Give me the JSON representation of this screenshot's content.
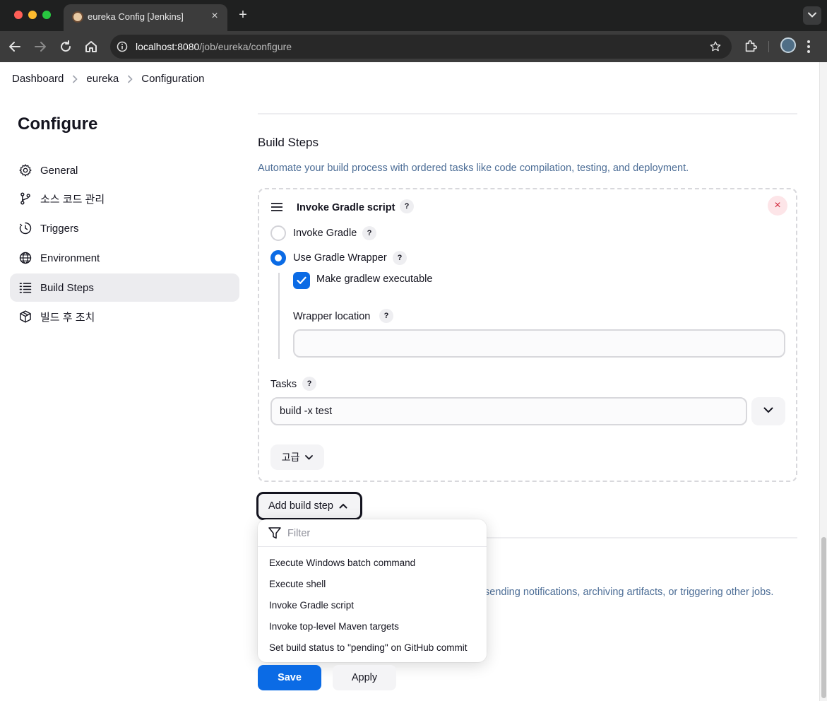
{
  "browser": {
    "tab_title": "eureka Config [Jenkins]",
    "url_host": "localhost:8080",
    "url_path": "/job/eureka/configure",
    "close_glyph": "×",
    "newtab_glyph": "+"
  },
  "breadcrumb": [
    {
      "label": "Dashboard"
    },
    {
      "label": "eureka"
    },
    {
      "label": "Configuration"
    }
  ],
  "sidebar": {
    "title": "Configure",
    "items": [
      {
        "label": "General",
        "icon": "gear-icon"
      },
      {
        "label": "소스 코드 관리",
        "icon": "branch-icon"
      },
      {
        "label": "Triggers",
        "icon": "timer-icon"
      },
      {
        "label": "Environment",
        "icon": "globe-icon"
      },
      {
        "label": "Build Steps",
        "icon": "list-icon",
        "active": true
      },
      {
        "label": "빌드 후 조치",
        "icon": "package-icon"
      }
    ]
  },
  "build_steps": {
    "title": "Build Steps",
    "description": "Automate your build process with ordered tasks like code compilation, testing, and deployment.",
    "step": {
      "title": "Invoke Gradle script",
      "help": "?",
      "close_glyph": "×",
      "options": [
        {
          "label": "Invoke Gradle",
          "selected": false
        },
        {
          "label": "Use Gradle Wrapper",
          "selected": true
        }
      ],
      "make_executable_label": "Make gradlew executable",
      "make_executable_checked": true,
      "wrapper_location_label": "Wrapper location",
      "wrapper_location_value": "",
      "tasks_label": "Tasks",
      "tasks_value": "build -x test",
      "advanced_label": "고급"
    },
    "add_button": "Add build step"
  },
  "dropdown": {
    "filter_placeholder": "Filter",
    "items": [
      "Execute Windows batch command",
      "Execute shell",
      "Invoke Gradle script",
      "Invoke top-level Maven targets",
      "Set build status to \"pending\" on GitHub commit"
    ]
  },
  "post_build": {
    "description_partial": "sending notifications, archiving artifacts, or triggering other jobs."
  },
  "footer": {
    "save_label": "Save",
    "apply_label": "Apply"
  },
  "colors": {
    "accent": "#0b6be5",
    "link_text": "#4c6d96",
    "danger": "#d1283b"
  }
}
